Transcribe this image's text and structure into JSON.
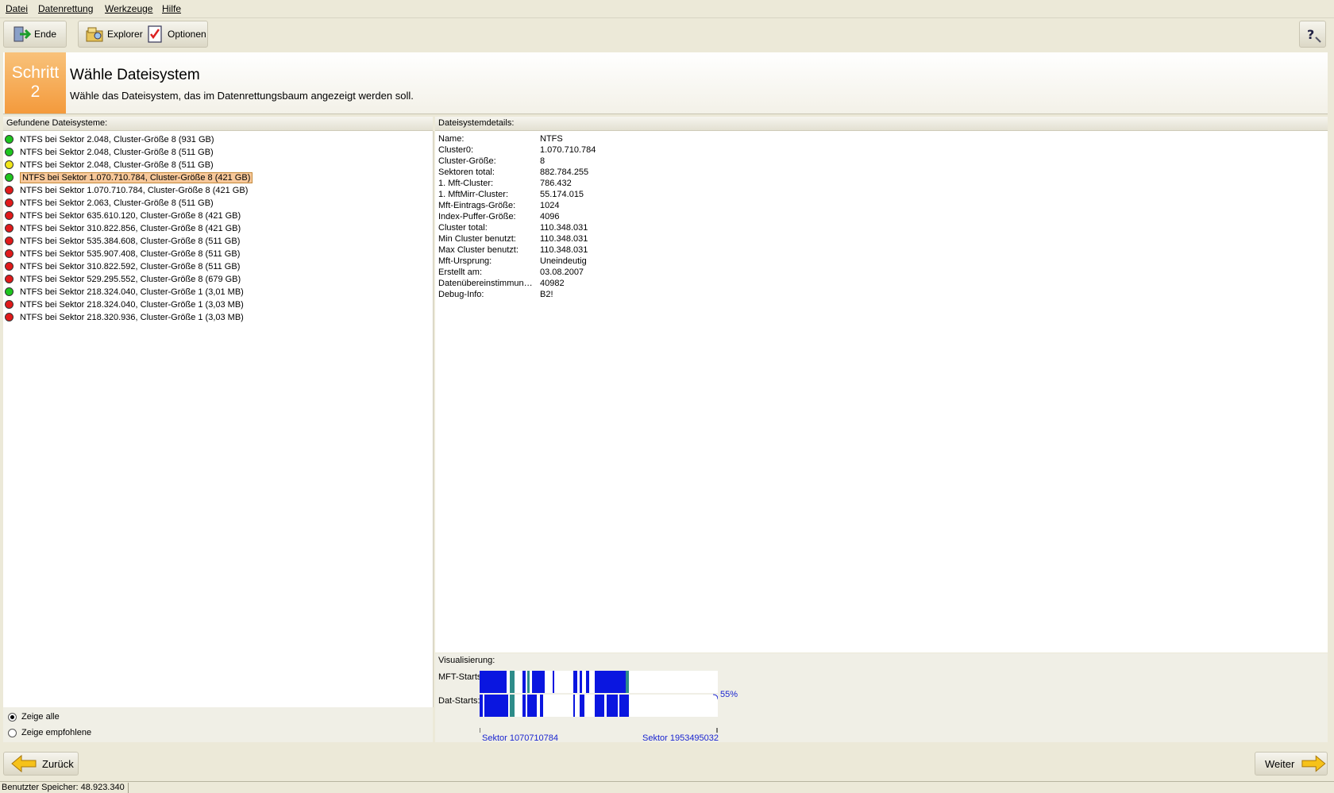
{
  "menu": [
    "Datei",
    "Datenrettung",
    "Werkzeuge",
    "Hilfe"
  ],
  "toolbar": {
    "end_label": "Ende",
    "explorer_label": "Explorer",
    "options_label": "Optionen"
  },
  "header": {
    "step_label": "Schritt",
    "step_number": "2",
    "title": "Wähle Dateisystem",
    "subtitle": "Wähle das Dateisystem, das im Datenrettungsbaum angezeigt werden soll."
  },
  "left_panel": {
    "title": "Gefundene Dateisysteme:",
    "items": [
      {
        "label": "NTFS bei Sektor 2.048, Cluster-Größe 8 (931 GB)",
        "status": "green"
      },
      {
        "label": "NTFS bei Sektor 2.048, Cluster-Größe 8 (511 GB)",
        "status": "green"
      },
      {
        "label": "NTFS bei Sektor 2.048, Cluster-Größe 8 (511 GB)",
        "status": "yellow"
      },
      {
        "label": "NTFS bei Sektor 1.070.710.784, Cluster-Größe 8 (421 GB)",
        "status": "green",
        "selected": true
      },
      {
        "label": "NTFS bei Sektor 1.070.710.784, Cluster-Größe 8 (421 GB)",
        "status": "red"
      },
      {
        "label": "NTFS bei Sektor 2.063, Cluster-Größe 8 (511 GB)",
        "status": "red"
      },
      {
        "label": "NTFS bei Sektor 635.610.120, Cluster-Größe 8 (421 GB)",
        "status": "red"
      },
      {
        "label": "NTFS bei Sektor 310.822.856, Cluster-Größe 8 (421 GB)",
        "status": "red"
      },
      {
        "label": "NTFS bei Sektor 535.384.608, Cluster-Größe 8 (511 GB)",
        "status": "red"
      },
      {
        "label": "NTFS bei Sektor 535.907.408, Cluster-Größe 8 (511 GB)",
        "status": "red"
      },
      {
        "label": "NTFS bei Sektor 310.822.592, Cluster-Größe 8 (511 GB)",
        "status": "red"
      },
      {
        "label": "NTFS bei Sektor 529.295.552, Cluster-Größe 8 (679 GB)",
        "status": "red"
      },
      {
        "label": "NTFS bei Sektor 218.324.040, Cluster-Größe 1 (3,01 MB)",
        "status": "green"
      },
      {
        "label": "NTFS bei Sektor 218.324.040, Cluster-Größe 1 (3,03 MB)",
        "status": "red"
      },
      {
        "label": "NTFS bei Sektor 218.320.936, Cluster-Größe 1 (3,03 MB)",
        "status": "red"
      }
    ],
    "radio_all": "Zeige alle",
    "radio_recommended": "Zeige empfohlene",
    "radio_selected": "all"
  },
  "right_panel": {
    "title": "Dateisystemdetails:",
    "details": [
      {
        "key": "Name:",
        "value": "NTFS"
      },
      {
        "key": "Cluster0:",
        "value": "1.070.710.784"
      },
      {
        "key": "Cluster-Größe:",
        "value": "8"
      },
      {
        "key": "Sektoren total:",
        "value": "882.784.255"
      },
      {
        "key": "1. Mft-Cluster:",
        "value": "786.432"
      },
      {
        "key": "1. MftMirr-Cluster:",
        "value": "55.174.015"
      },
      {
        "key": "Mft-Eintrags-Größe:",
        "value": "1024"
      },
      {
        "key": "Index-Puffer-Größe:",
        "value": "4096"
      },
      {
        "key": "Cluster total:",
        "value": "110.348.031"
      },
      {
        "key": "Min Cluster benutzt:",
        "value": "110.348.031"
      },
      {
        "key": "Max Cluster benutzt:",
        "value": "110.348.031"
      },
      {
        "key": "Mft-Ursprung:",
        "value": "Uneindeutig"
      },
      {
        "key": "Erstellt am:",
        "value": "03.08.2007"
      },
      {
        "key": "Datenübereinstimmun…",
        "value": "40982"
      },
      {
        "key": "Debug-Info:",
        "value": "B2!"
      }
    ]
  },
  "visualization": {
    "title": "Visualisierung:",
    "mft_label": "MFT-Starts",
    "dat_label": "Dat-Starts:",
    "percent": "55%",
    "sector_start": "Sektor 1070710784",
    "sector_end": "Sektor 1953495032",
    "colors": {
      "blue": "#0a16e0",
      "teal": "#2e8c8a"
    }
  },
  "buttons": {
    "back": "Zurück",
    "next": "Weiter"
  },
  "status": {
    "memory": "Benutzter Speicher: 48.923.340"
  }
}
